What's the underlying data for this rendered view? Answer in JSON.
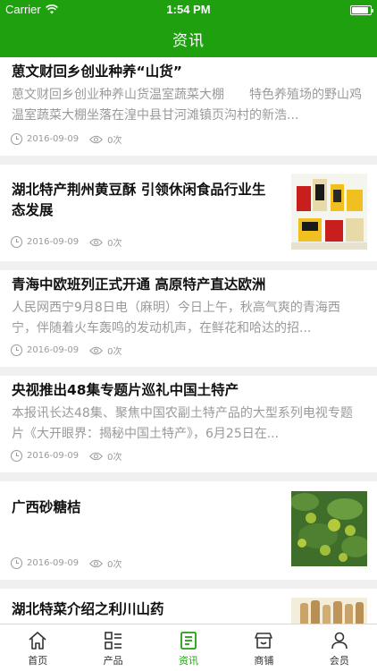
{
  "status_bar": {
    "carrier": "Carrier",
    "time": "1:54 PM",
    "battery_level": 0.92
  },
  "nav": {
    "title": "资讯"
  },
  "articles": [
    {
      "title": "葸文财回乡创业种养“山货”",
      "excerpt": "葸文财回乡创业种养山货温室蔬菜大棚　　特色养殖场的野山鸡温室蔬菜大棚坐落在湟中县甘河滩镇页沟村的新浩...",
      "date": "2016-09-09",
      "views": "0次",
      "thumbnail": ""
    },
    {
      "title": "湖北特产荆州黄豆酥 引领休闲食品行业生态发展",
      "excerpt": "",
      "date": "2016-09-09",
      "views": "0次",
      "thumbnail": "snack-packages"
    },
    {
      "title": "青海中欧班列正式开通 高原特产直达欧洲",
      "excerpt": "人民网西宁9月8日电（麻明）今日上午，秋高气爽的青海西宁，伴随着火车轰鸣的发动机声，在鲜花和哈达的招...",
      "date": "2016-09-09",
      "views": "0次",
      "thumbnail": ""
    },
    {
      "title": "央视推出48集专题片巡礼中国土特产",
      "excerpt": "本报讯长达48集、聚焦中国农副土特产品的大型系列电视专题片《大开眼界：揭秘中国土特产》，6月25日在...",
      "date": "2016-09-09",
      "views": "0次",
      "thumbnail": ""
    },
    {
      "title": "广西砂糖桔",
      "excerpt": "",
      "date": "2016-09-09",
      "views": "0次",
      "thumbnail": "oranges-on-tree"
    },
    {
      "title": "湖北特菜介绍之利川山药",
      "excerpt": "",
      "date": "",
      "views": "",
      "thumbnail": "yam-roots"
    }
  ],
  "tabbar": {
    "tabs": [
      {
        "label": "首页",
        "icon": "home-icon",
        "active": false
      },
      {
        "label": "产品",
        "icon": "grid-list-icon",
        "active": false
      },
      {
        "label": "资讯",
        "icon": "news-doc-icon",
        "active": true
      },
      {
        "label": "商铺",
        "icon": "store-icon",
        "active": false
      },
      {
        "label": "会员",
        "icon": "person-icon",
        "active": false
      }
    ]
  },
  "colors": {
    "brand_green": "#1fa10f",
    "separator": "#f0f0f0",
    "muted_text": "#9a9a9a"
  }
}
